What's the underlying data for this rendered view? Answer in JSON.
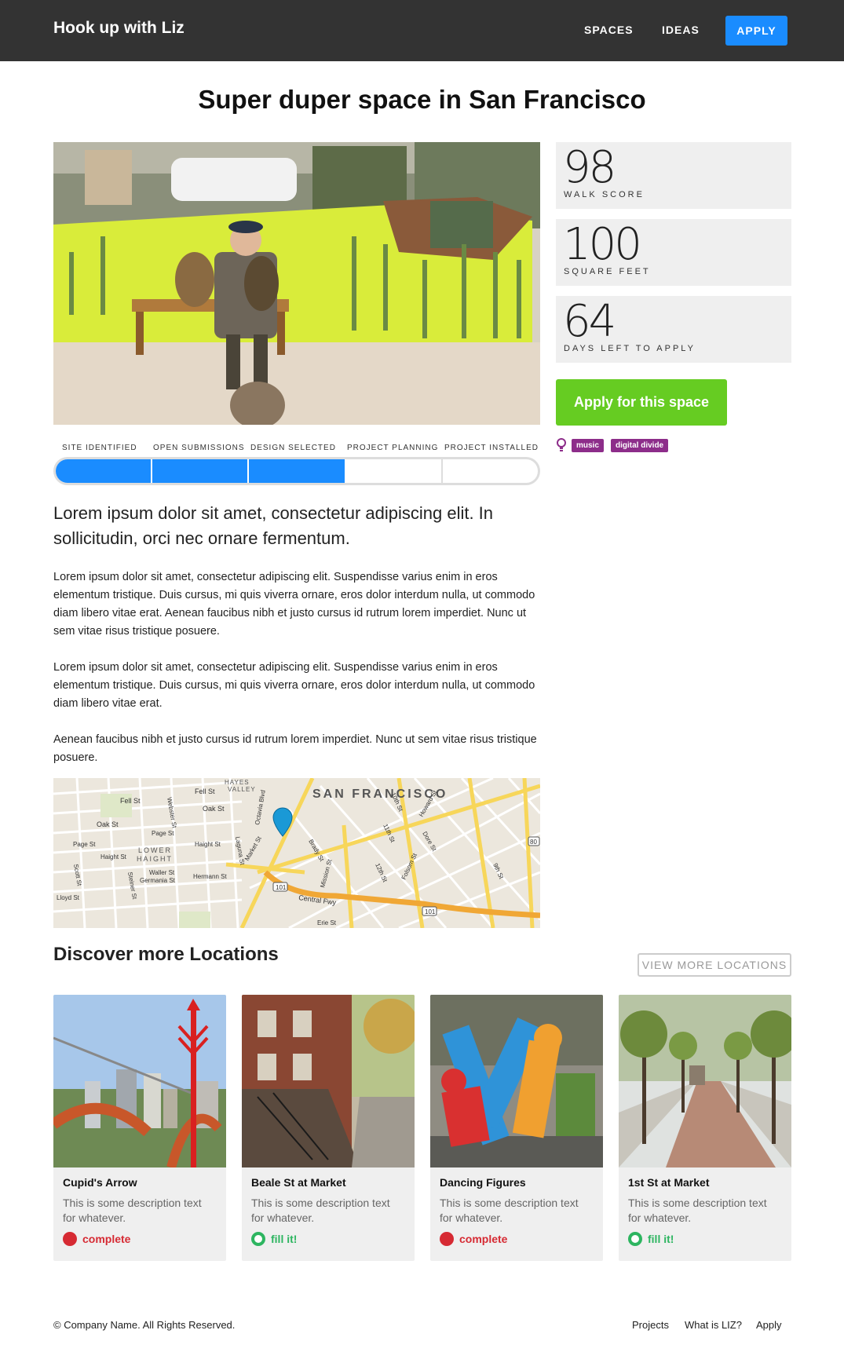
{
  "header": {
    "brand": "Hook up with Liz",
    "nav": {
      "spaces": "SPACES",
      "ideas": "IDEAS",
      "apply": "APPLY"
    }
  },
  "page": {
    "title": "Super duper space in San Francisco"
  },
  "stats": [
    {
      "value": "98",
      "label": "WALK SCORE"
    },
    {
      "value": "100",
      "label": "SQUARE FEET"
    },
    {
      "value": "64",
      "label": "DAYS LEFT TO APPLY"
    }
  ],
  "apply_button": "Apply for this space",
  "tags": [
    "music",
    "digital divide"
  ],
  "progress": {
    "stages": [
      "SITE IDENTIFIED",
      "OPEN SUBMISSIONS",
      "DESIGN SELECTED",
      "PROJECT PLANNING",
      "PROJECT INSTALLED"
    ],
    "completed": 3,
    "total": 5
  },
  "content": {
    "lead": "Lorem ipsum dolor sit amet, consectetur adipiscing elit. In sollicitudin, orci nec ornare fermentum.",
    "paragraphs": [
      "Lorem ipsum dolor sit amet, consectetur adipiscing elit. Suspendisse varius enim in eros elementum tristique. Duis cursus, mi quis viverra ornare, eros dolor interdum nulla, ut commodo diam libero vitae erat. Aenean faucibus nibh et justo cursus id rutrum lorem imperdiet. Nunc ut sem vitae risus tristique posuere.",
      "Lorem ipsum dolor sit amet, consectetur adipiscing elit. Suspendisse varius enim in eros elementum tristique. Duis cursus, mi quis viverra ornare, eros dolor interdum nulla, ut commodo diam libero vitae erat.",
      "Aenean faucibus nibh et justo cursus id rutrum lorem imperdiet. Nunc ut sem vitae risus tristique posuere."
    ]
  },
  "map": {
    "city": "SAN FRANCISCO",
    "labels": [
      "Fell St",
      "Oak St",
      "Page St",
      "Haight St",
      "LOWER",
      "HAIGHT",
      "Market St",
      "Mission St",
      "Howard St",
      "Folsom St",
      "Central Fwy",
      "Octavia Blvd",
      "Webster St",
      "Laguna St",
      "9th St",
      "10th St",
      "11th St",
      "12th St",
      "Brady St",
      "Hermann St",
      "Waller St",
      "Germania St",
      "Scott St",
      "Steiner St",
      "Lloyd St",
      "Dore St",
      "Erie St",
      "HAYES",
      "VALLEY",
      "101",
      "80"
    ]
  },
  "discover": {
    "title": "Discover more Locations",
    "view_more": "VIEW MORE LOCATIONS",
    "cards": [
      {
        "title": "Cupid's Arrow",
        "desc": "This is some description text for whatever.",
        "status": "complete",
        "status_type": "complete"
      },
      {
        "title": "Beale St at Market",
        "desc": "This is some description text for whatever.",
        "status": "fill it!",
        "status_type": "fill"
      },
      {
        "title": "Dancing Figures",
        "desc": "This is some description text for whatever.",
        "status": "complete",
        "status_type": "complete"
      },
      {
        "title": "1st St at Market",
        "desc": "This is some description text for whatever.",
        "status": "fill it!",
        "status_type": "fill"
      }
    ]
  },
  "footer": {
    "copyright": "© Company Name. All Rights Reserved.",
    "links": [
      "Projects",
      "What is LIZ?",
      "Apply"
    ]
  },
  "colors": {
    "header_bg": "#333333",
    "accent_blue": "#1a8cff",
    "apply_green": "#66cc22",
    "tag_purple": "#8d2d8a",
    "complete_red": "#d62a33",
    "fill_green": "#2db560"
  }
}
